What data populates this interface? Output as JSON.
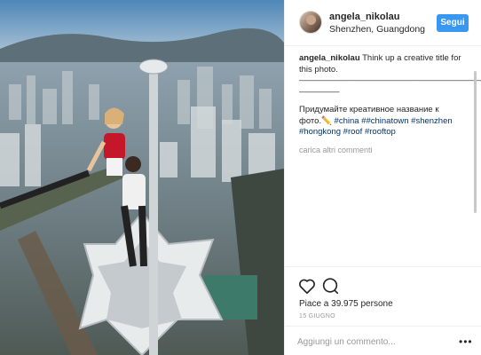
{
  "post": {
    "username": "angela_nikolau",
    "location": "Shenzhen, Guangdong",
    "follow_label": "Segui",
    "caption_user": "angela_nikolau",
    "caption_text": "Think up a creative title for this photo.",
    "divider_long": "————————————————————————",
    "divider_short": "—————",
    "caption_ru": "Придумайте креативное название к фото.✏️",
    "hashtags": [
      "#china",
      "##chinatown",
      "#shenzhen",
      "#hongkong",
      "#roof",
      "#rooftop"
    ],
    "more_comments": "carica altri commenti",
    "likes": "Piace a 39.975 persone",
    "date": "15 GIUGNO",
    "comment_placeholder": "Aggiungi un commento...",
    "more_options": "•••"
  },
  "icons": {
    "like": "heart-icon",
    "comment": "comment-icon",
    "more": "more-options-icon"
  },
  "colors": {
    "accent": "#3897f0",
    "hashtag": "#003569",
    "muted": "#999999"
  }
}
